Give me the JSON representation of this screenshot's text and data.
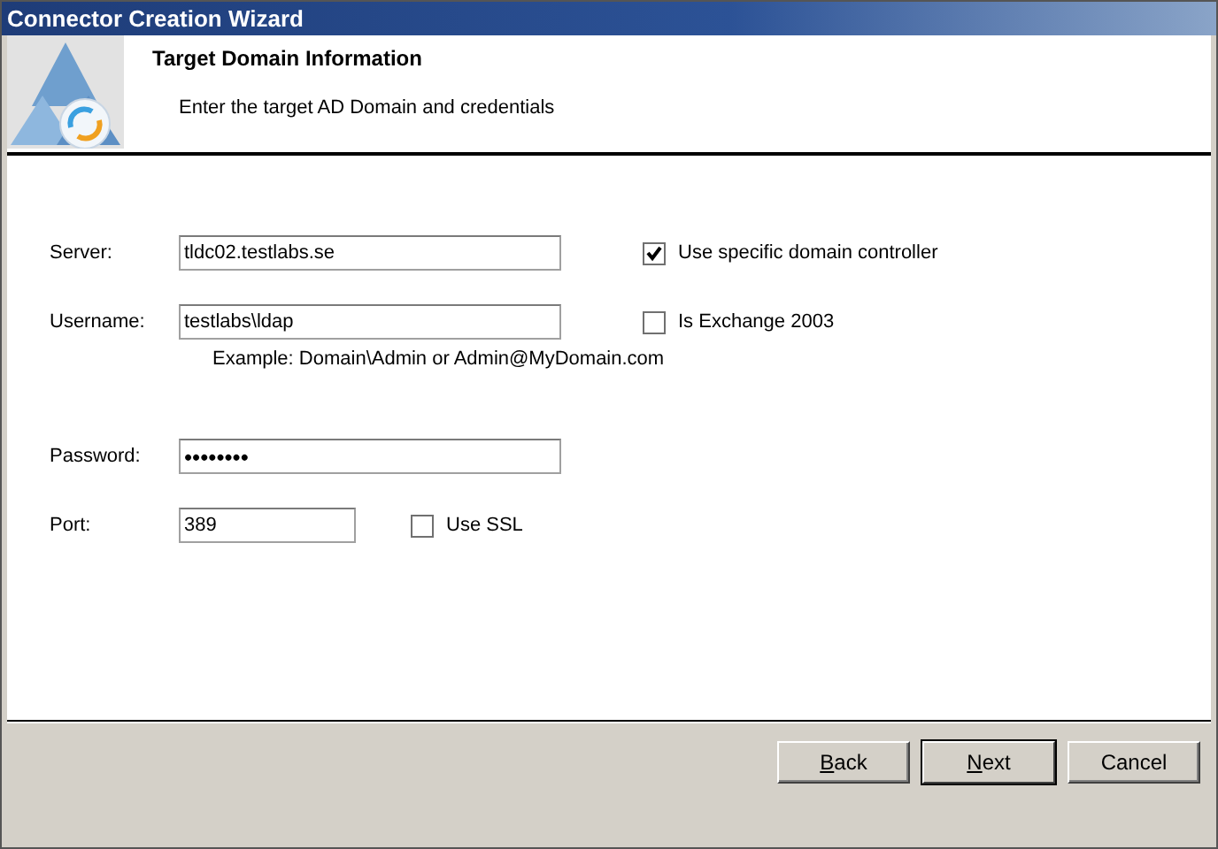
{
  "window": {
    "title": "Connector Creation Wizard"
  },
  "header": {
    "title": "Target Domain Information",
    "subtitle": "Enter the target AD Domain and credentials"
  },
  "form": {
    "server": {
      "label": "Server:",
      "value": "tldc02.testlabs.se"
    },
    "use_specific_dc": {
      "label": "Use specific domain controller",
      "checked": true
    },
    "username": {
      "label": "Username:",
      "value": "testlabs\\ldap"
    },
    "is_exchange_2003": {
      "label": "Is Exchange 2003",
      "checked": false
    },
    "username_hint": "Example: Domain\\Admin or Admin@MyDomain.com",
    "password": {
      "label": "Password:",
      "value": "••••••••"
    },
    "port": {
      "label": "Port:",
      "value": "389"
    },
    "use_ssl": {
      "label": "Use SSL",
      "checked": false
    }
  },
  "buttons": [
    {
      "label": "Back",
      "first_letter_underlined": true,
      "default": false
    },
    {
      "label": "Next",
      "first_letter_underlined": true,
      "default": true
    },
    {
      "label": "Cancel",
      "first_letter_underlined": false,
      "default": false
    }
  ]
}
